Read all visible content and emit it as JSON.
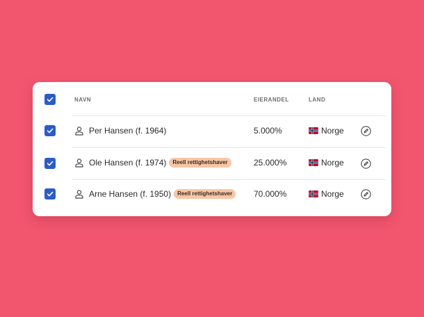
{
  "colors": {
    "background": "#f2566f",
    "accent": "#2b5cc8",
    "badge": "#f7c6a6"
  },
  "header": {
    "select_all_checked": true,
    "col_name": "NAVN",
    "col_share": "EIERANDEL",
    "col_country": "LAND"
  },
  "rows": [
    {
      "checked": true,
      "name": "Per Hansen (f. 1964)",
      "badge": "",
      "share": "5.000%",
      "country": "Norge",
      "icon": "person-icon",
      "flag": "norway-flag-icon"
    },
    {
      "checked": true,
      "name": "Ole Hansen (f. 1974)",
      "badge": "Reell rettighetshaver",
      "share": "25.000%",
      "country": "Norge",
      "icon": "person-icon",
      "flag": "norway-flag-icon"
    },
    {
      "checked": true,
      "name": "Arne Hansen (f. 1950)",
      "badge": "Reell rettighetshaver",
      "share": "70.000%",
      "country": "Norge",
      "icon": "person-icon",
      "flag": "norway-flag-icon"
    }
  ]
}
